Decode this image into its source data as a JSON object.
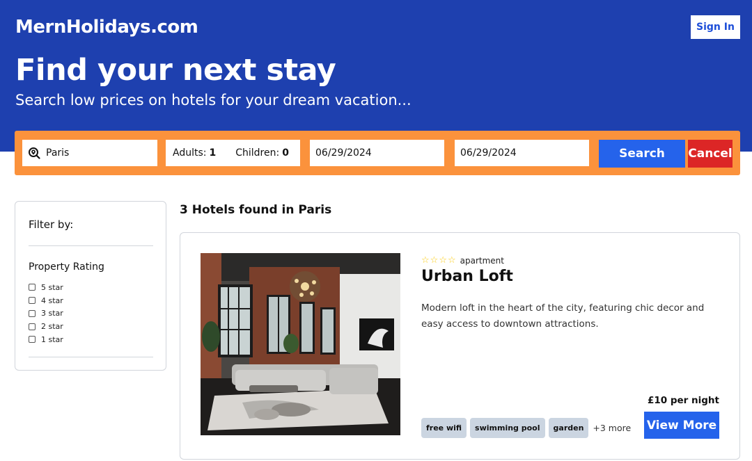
{
  "header": {
    "brand": "MernHolidays.com",
    "sign_in_label": "Sign In",
    "headline": "Find your next stay",
    "subheadline": "Search low prices on hotels for your dream vacation..."
  },
  "search": {
    "destination": "Paris",
    "adults_label": "Adults:",
    "adults_value": "1",
    "children_label": "Children:",
    "children_value": "0",
    "check_in": "06/29/2024",
    "check_out": "06/29/2024",
    "search_label": "Search",
    "cancel_label": "Cancel",
    "icon": "map-search-icon"
  },
  "filter": {
    "title": "Filter by:",
    "section_title": "Property Rating",
    "options": [
      {
        "label": "5 star",
        "checked": false
      },
      {
        "label": "4 star",
        "checked": false
      },
      {
        "label": "3 star",
        "checked": false
      },
      {
        "label": "2 star",
        "checked": false
      },
      {
        "label": "1 star",
        "checked": false
      }
    ]
  },
  "results": {
    "title": "3 Hotels found in Paris"
  },
  "hotel": {
    "stars": 4,
    "type": "apartment",
    "name": "Urban Loft",
    "description": "Modern loft in the heart of the city, featuring chic decor and easy access to downtown attractions.",
    "price": "£10 per night",
    "facilities": [
      "free wifi",
      "swimming pool",
      "garden"
    ],
    "more": "+3 more",
    "view_more_label": "View More"
  },
  "colors": {
    "hero": "#1e40af",
    "search_bar": "#fb923c",
    "primary_button": "#2563eb",
    "cancel_button": "#dc2626",
    "chip": "#cbd5e1",
    "star": "#facc15"
  }
}
